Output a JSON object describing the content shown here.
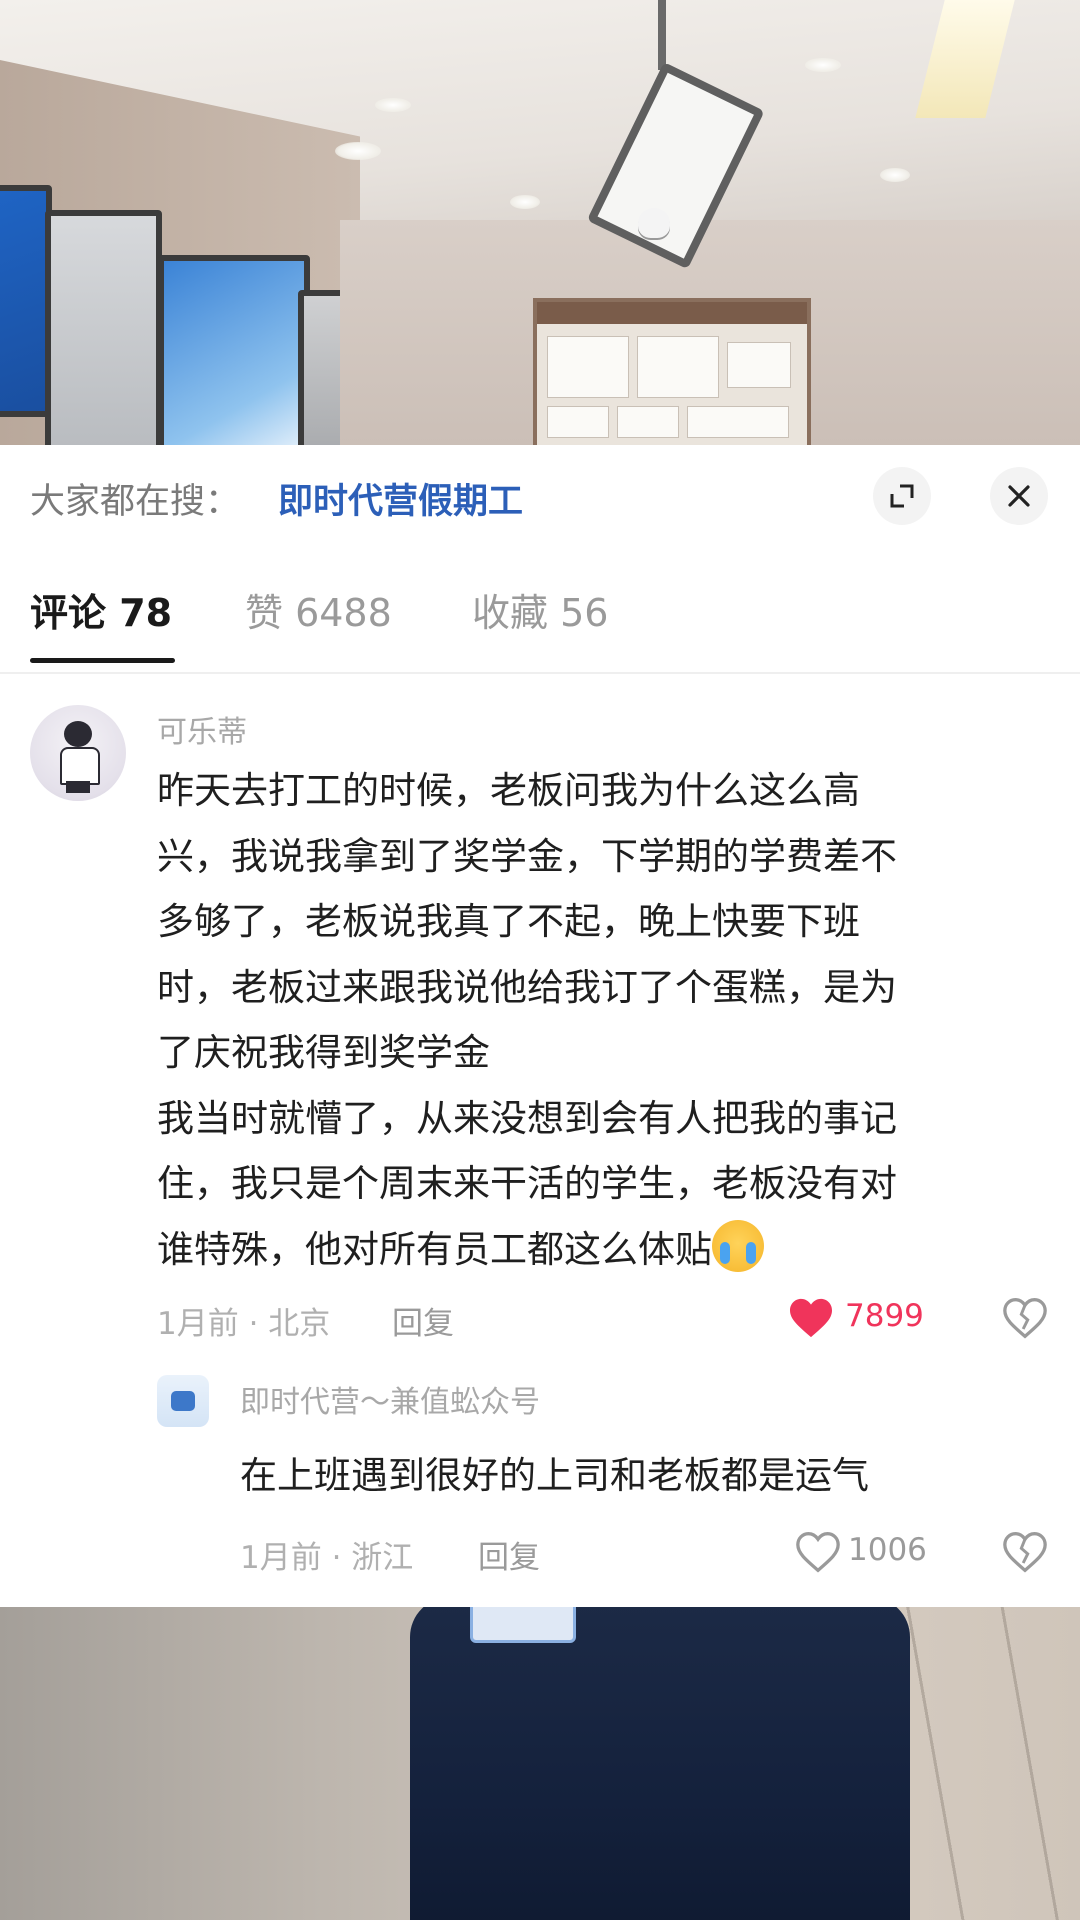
{
  "search": {
    "prefix": "大家都在搜：",
    "term": "即时代营假期工"
  },
  "icons": {
    "expand": "expand-icon",
    "close": "close-icon",
    "heart_filled": "heart-filled-icon",
    "heart_outline": "heart-outline-icon",
    "dislike": "broken-heart-icon"
  },
  "tabs": [
    {
      "label": "评论 78",
      "active": true
    },
    {
      "label": "赞 6488",
      "active": false
    },
    {
      "label": "收藏 56",
      "active": false
    }
  ],
  "comments": [
    {
      "user": "可乐蒂",
      "lines": [
        "昨天去打工的时候，老板问我为什么这么高",
        "兴，我说我拿到了奖学金，下学期的学费差不",
        "多够了，老板说我真了不起，晚上快要下班",
        "时，老板过来跟我说他给我订了个蛋糕，是为",
        "了庆祝我得到奖学金",
        "我当时就懵了，从来没想到会有人把我的事记",
        "住，我只是个周末来干活的学生，老板没有对",
        "谁特殊，他对所有员工都这么体贴"
      ],
      "meta": "1月前 · 北京",
      "reply": "回复",
      "likes": "7899",
      "liked": true
    }
  ],
  "replies": [
    {
      "user": "即时代营～兼值蚣众号",
      "text": "在上班遇到很好的上司和老板都是运气",
      "meta": "1月前 · 浙江",
      "reply": "回复",
      "likes": "1006"
    }
  ],
  "colors": {
    "accent": "#2c5fb8",
    "like": "#f0345b",
    "muted": "#a8a8a8"
  }
}
